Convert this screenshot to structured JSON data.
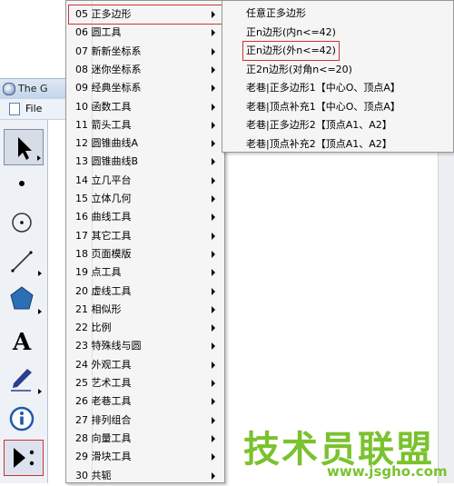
{
  "window": {
    "title": "The G",
    "menu_file": "File"
  },
  "main_menu": {
    "items": [
      {
        "label": "05 正多边形",
        "active": true
      },
      {
        "label": "06 圆工具"
      },
      {
        "label": "07 新新坐标系"
      },
      {
        "label": "08 迷你坐标系"
      },
      {
        "label": "09 经典坐标系"
      },
      {
        "label": "10 函数工具"
      },
      {
        "label": "11 箭头工具"
      },
      {
        "label": "12 圆锥曲线A"
      },
      {
        "label": "13 圆锥曲线B"
      },
      {
        "label": "14 立几平台"
      },
      {
        "label": "15 立体几何"
      },
      {
        "label": "16 曲线工具"
      },
      {
        "label": "17 其它工具"
      },
      {
        "label": "18 页面模版"
      },
      {
        "label": "19 点工具"
      },
      {
        "label": "20 虚线工具"
      },
      {
        "label": "21 相似形"
      },
      {
        "label": "22 比例"
      },
      {
        "label": "23 特殊线与圆"
      },
      {
        "label": "24 外观工具"
      },
      {
        "label": "25 艺术工具"
      },
      {
        "label": "26 老巷工具"
      },
      {
        "label": "27 排列组合"
      },
      {
        "label": "28 向量工具"
      },
      {
        "label": "29 滑块工具"
      },
      {
        "label": "30 共轭"
      }
    ]
  },
  "sub_menu": {
    "items": [
      {
        "label": "任意正多边形"
      },
      {
        "label": "正n边形(内n<=42)"
      },
      {
        "label": "正n边形(外n<=42)",
        "highlight": true
      },
      {
        "label": "正2n边形(对角n<=20)"
      },
      {
        "label": "老巷|正多边形1【中心O、顶点A】"
      },
      {
        "label": "老巷|顶点补充1【中心O、顶点A】"
      },
      {
        "label": "老巷|正多边形2【顶点A1、A2】"
      },
      {
        "label": "老巷|顶点补充2【顶点A1、A2】"
      }
    ]
  },
  "watermark": {
    "text": "技术员联盟",
    "url": "www.jsgho.com"
  },
  "colors": {
    "highlight_border": "#cc3333",
    "watermark": "#7ac22e"
  }
}
